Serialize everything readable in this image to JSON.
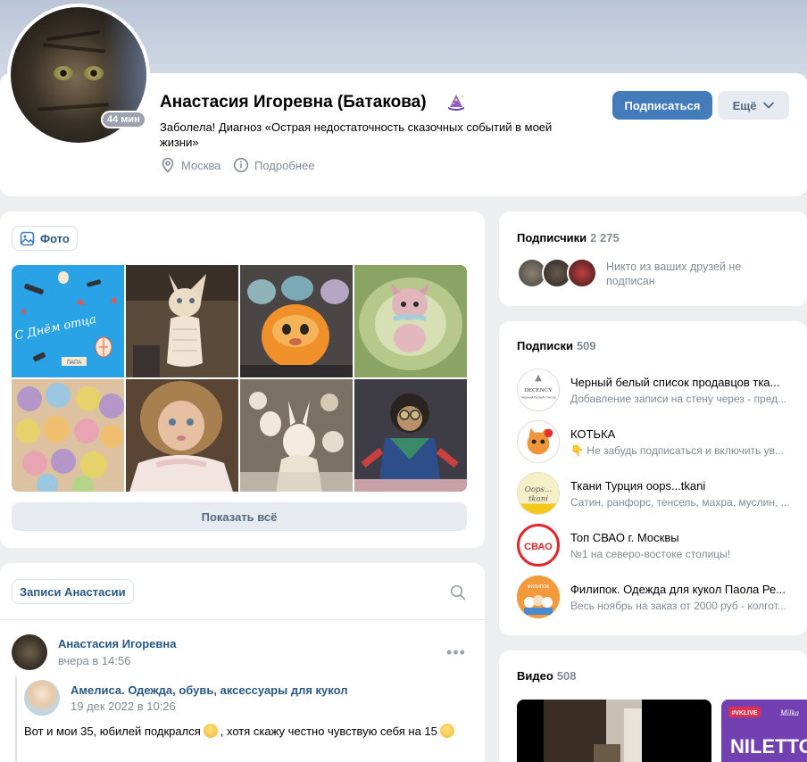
{
  "profile": {
    "name": "Анастасия Игоревна (Батакова)",
    "online": "44 мин",
    "status": "Заболела! Диагноз «Острая недостаточность сказочных событий в моей жизни»",
    "city": "Москва",
    "details": "Подробнее",
    "subscribe_label": "Подписаться",
    "more_label": "Ещё"
  },
  "photos": {
    "tab_label": "Фото",
    "show_all": "Показать всё",
    "card_text": "С Днём отца",
    "card_tag": "ПАПА"
  },
  "wall": {
    "tab_label": "Записи Анастасии",
    "post": {
      "author": "Анастасия Игоревна",
      "date": "вчера в 14:56",
      "repost_author": "Амелиса. Одежда, обувь, аксессуары для кукол",
      "repost_date": "19 дек 2022 в 10:26",
      "text_part1": "Вот и мои 35, юбилей подкрался",
      "text_part2": ", хотя скажу честно чувствую себя на 15"
    }
  },
  "subscribers": {
    "title": "Подписчики",
    "count": "2 275",
    "note": "Никто из ваших друзей не подписан"
  },
  "following": {
    "title": "Подписки",
    "count": "509",
    "items": [
      {
        "title": "Черный белый список продавцов тка...",
        "desc": "Добавление записи на стену через - пред...",
        "logo": "DECENCY",
        "logo_sub": "Черный белый список"
      },
      {
        "title": "КОТЬКА",
        "desc": "👇 Не забудь подписаться и включить ув..."
      },
      {
        "title": "Ткани Турция oops...tkani",
        "desc": "Сатин, ранфорс, тенсель, махра, муслин, ...",
        "logo": "Oops...",
        "logo_sub": "tkani"
      },
      {
        "title": "Топ СВАО г. Москвы",
        "desc": "№1 на северо-востоке столицы!",
        "logo": "СВАО"
      },
      {
        "title": "Филипок. Одежда для кукол Паола Ре...",
        "desc": "Весь ноябрь на заказ от 2000 руб - колгот...",
        "logo": "ФИЛИПОК"
      }
    ]
  },
  "videos": {
    "title": "Видео",
    "count": "508",
    "thumb2_badge": "#VKLIVE",
    "thumb2_brand": "Milka",
    "thumb2_text": "NILETTO"
  },
  "colors": {
    "accent": "#447bba",
    "link": "#2a5885",
    "secondary_text": "#818c99",
    "secondary_button": "#e5ebf1"
  }
}
